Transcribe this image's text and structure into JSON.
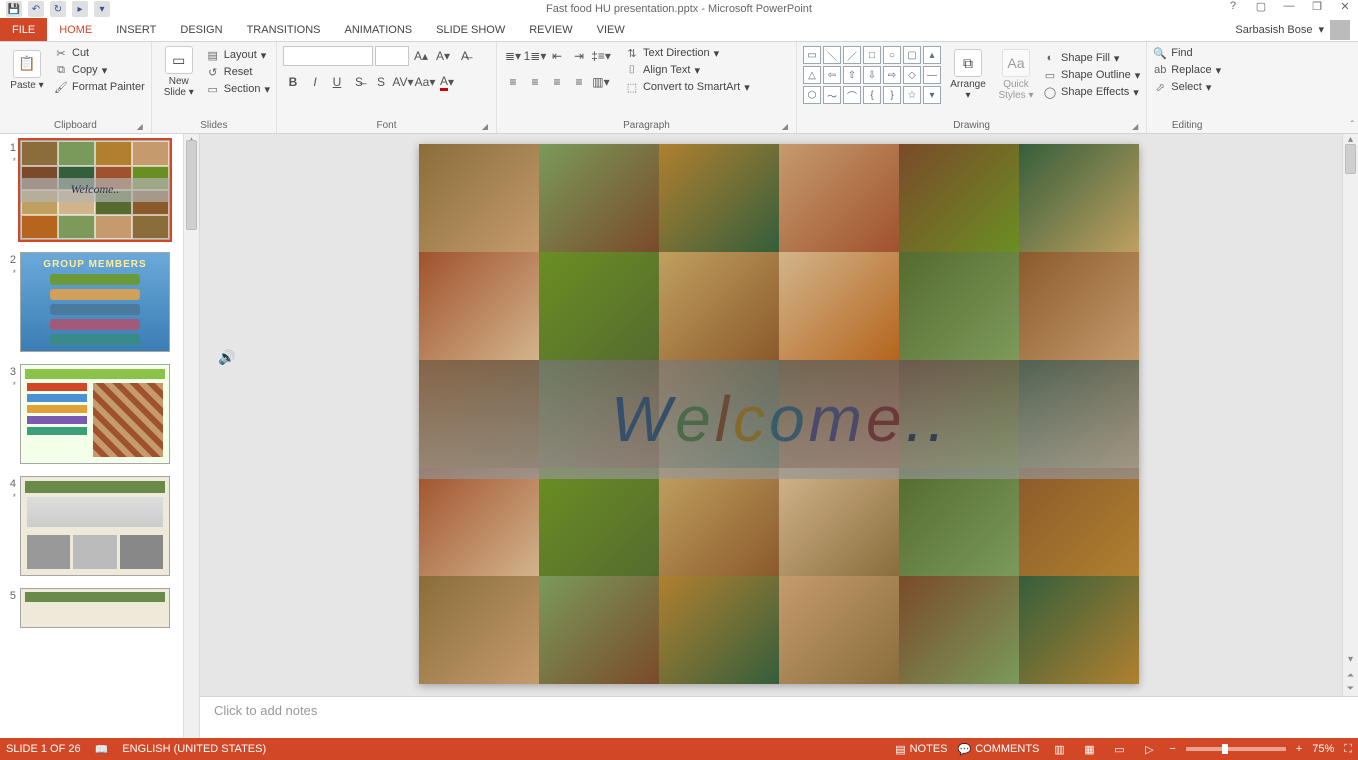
{
  "app": {
    "title": "Fast food HU presentation.pptx - Microsoft PowerPoint",
    "user_name": "Sarbasish Bose"
  },
  "tabs": {
    "file": "FILE",
    "items": [
      "HOME",
      "INSERT",
      "DESIGN",
      "TRANSITIONS",
      "ANIMATIONS",
      "SLIDE SHOW",
      "REVIEW",
      "VIEW"
    ],
    "active": "HOME"
  },
  "ribbon": {
    "clipboard": {
      "label": "Clipboard",
      "paste": "Paste",
      "cut": "Cut",
      "copy": "Copy",
      "format_painter": "Format Painter"
    },
    "slides": {
      "label": "Slides",
      "new_slide_l1": "New",
      "new_slide_l2": "Slide",
      "layout": "Layout",
      "reset": "Reset",
      "section": "Section"
    },
    "font": {
      "label": "Font",
      "name": "",
      "size": ""
    },
    "paragraph": {
      "label": "Paragraph",
      "text_direction": "Text Direction",
      "align_text": "Align Text",
      "convert_smartart": "Convert to SmartArt"
    },
    "drawing": {
      "label": "Drawing",
      "arrange": "Arrange",
      "quick_styles_l1": "Quick",
      "quick_styles_l2": "Styles",
      "shape_fill": "Shape Fill",
      "shape_outline": "Shape Outline",
      "shape_effects": "Shape Effects"
    },
    "editing": {
      "label": "Editing",
      "find": "Find",
      "replace": "Replace",
      "select": "Select"
    }
  },
  "slides_panel": {
    "thumbs": [
      {
        "num": "1",
        "star": "*",
        "title": "Welcome.."
      },
      {
        "num": "2",
        "star": "*",
        "title": "GROUP MEMBERS"
      },
      {
        "num": "3",
        "star": "*",
        "title": ""
      },
      {
        "num": "4",
        "star": "*",
        "title": ""
      },
      {
        "num": "5",
        "star": "",
        "title": ""
      }
    ]
  },
  "canvas": {
    "welcome_text": "Welcome..",
    "welcome_colors": [
      "#36506a",
      "#4a6a4a",
      "#6a4a36",
      "#826a2f",
      "#3a5a6a",
      "#4a4a6a",
      "#6a3a3a",
      "#304050",
      "#304050"
    ]
  },
  "notes": {
    "placeholder": "Click to add notes"
  },
  "status": {
    "slide_counter": "SLIDE 1 OF 26",
    "language": "ENGLISH (UNITED STATES)",
    "notes": "NOTES",
    "comments": "COMMENTS",
    "zoom": "75%"
  },
  "collage_colors": [
    "#8a6d3b",
    "#7a9a5b",
    "#b08030",
    "#c59b6d",
    "#7a4a2a",
    "#355e3b",
    "#a0522d",
    "#6b8e23",
    "#c0a060",
    "#d2b48c",
    "#556b2f",
    "#8b5a2b",
    "#b5651d",
    "#7d9a5b",
    "#c59b6d",
    "#8a6d3b",
    "#7a4a2a",
    "#355e3b",
    "#a0522d",
    "#6b8e23",
    "#c0a060",
    "#d2b48c",
    "#556b2f",
    "#8b5a2b",
    "#8a6d3b",
    "#7a9a5b",
    "#b08030",
    "#c59b6d",
    "#7a4a2a",
    "#355e3b"
  ]
}
